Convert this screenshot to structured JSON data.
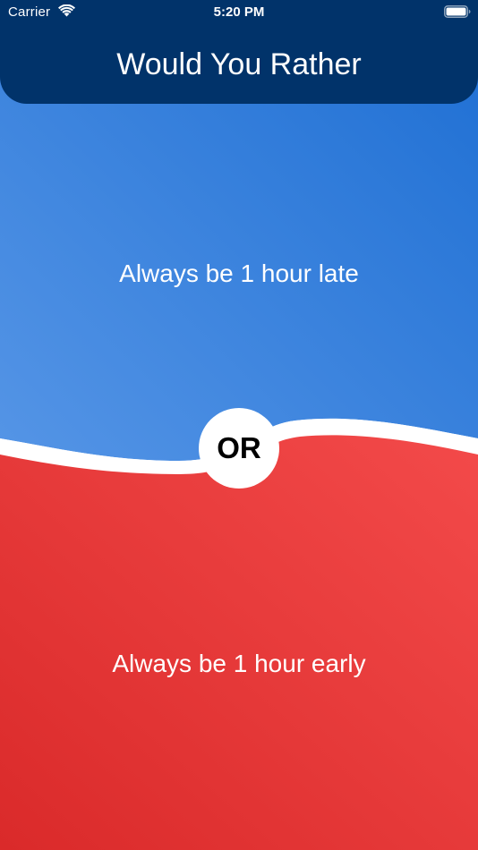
{
  "status_bar": {
    "carrier": "Carrier",
    "time": "5:20 PM"
  },
  "header": {
    "title": "Would You Rather"
  },
  "options": {
    "top": "Always be 1 hour late",
    "bottom": "Always be 1 hour early"
  },
  "divider": {
    "label": "OR"
  },
  "colors": {
    "header": "#01336a",
    "top_gradient_start": "#5595e6",
    "top_gradient_end": "#1d6ed3",
    "bottom_gradient_start": "#f34a4a",
    "bottom_gradient_end": "#da2a2a",
    "divider": "#ffffff"
  },
  "icons": {
    "wifi": "wifi-icon",
    "battery": "battery-icon"
  }
}
